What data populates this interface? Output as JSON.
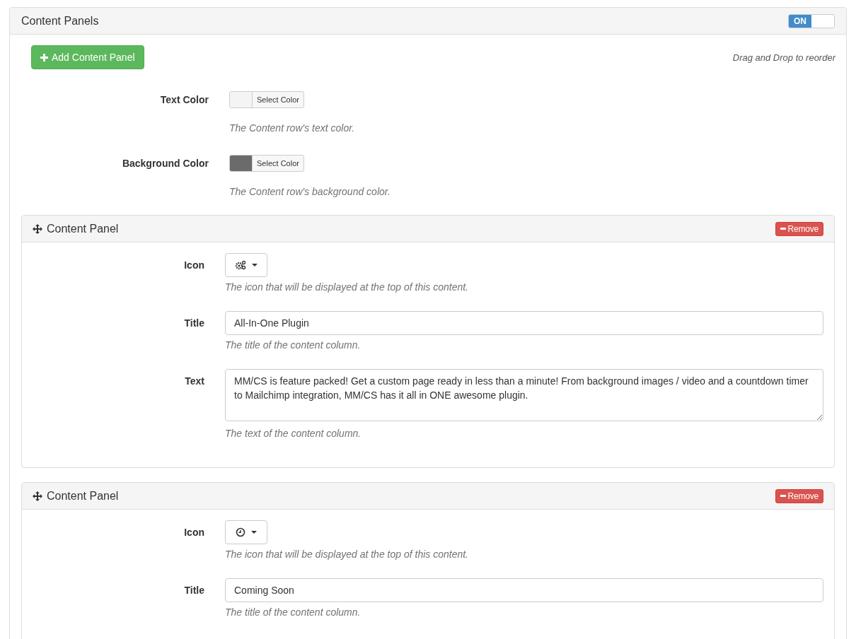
{
  "section": {
    "title": "Content Panels",
    "toggle": {
      "label": "ON",
      "on": true
    }
  },
  "add_button": {
    "label": "Add Content Panel"
  },
  "hint": "Drag and Drop to reorder",
  "color_settings": [
    {
      "label": "Text Color",
      "button": "Select Color",
      "color": "#f4f4f4",
      "help": "The Content row's text color."
    },
    {
      "label": "Background Color",
      "button": "Select Color",
      "color": "#6b6b6b",
      "help": "The Content row's background color."
    }
  ],
  "panels": [
    {
      "title": "Content Panel",
      "remove": "Remove",
      "fields": [
        {
          "kind": "icon",
          "label": "Icon",
          "help": "The icon that will be displayed at the top of this content."
        },
        {
          "kind": "input",
          "label": "Title",
          "value": "All-In-One Plugin",
          "help": "The title of the content column."
        },
        {
          "kind": "textarea",
          "label": "Text",
          "value": "MM/CS is feature packed! Get a custom page ready in less than a minute! From background images / video and a countdown timer to Mailchimp integration, MM/CS has it all in ONE awesome plugin.",
          "help": "The text of the content column."
        }
      ]
    },
    {
      "title": "Content Panel",
      "remove": "Remove",
      "fields": [
        {
          "kind": "icon",
          "label": "Icon",
          "help": "The icon that will be displayed at the top of this content."
        },
        {
          "kind": "input",
          "label": "Title",
          "value": "Coming Soon",
          "help": "The title of the content column."
        }
      ]
    }
  ]
}
